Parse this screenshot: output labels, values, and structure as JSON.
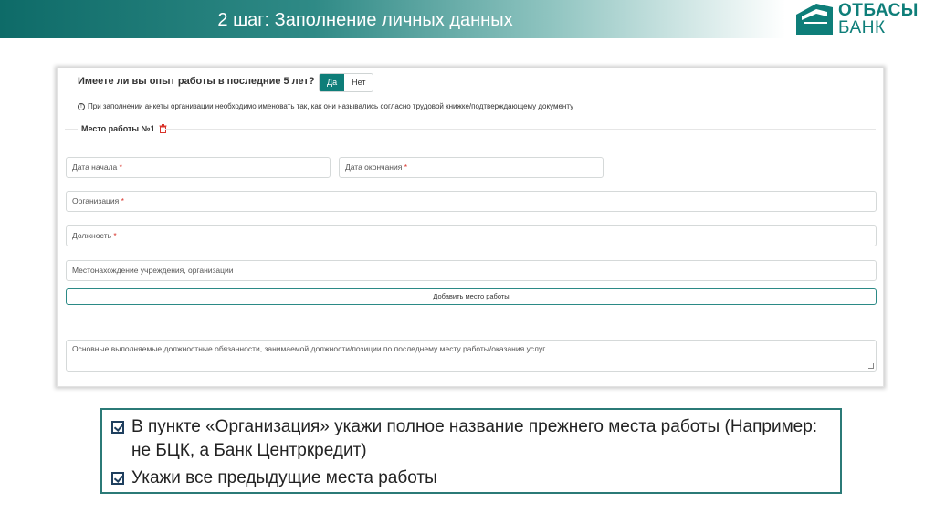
{
  "header": {
    "title": "2 шаг: Заполнение личных данных",
    "logo": {
      "line1": "ОТБАСЫ",
      "line2": "БАНК",
      "color": "#0e7e79"
    }
  },
  "form": {
    "question": "Имеете ли вы опыт работы в последние 5 лет?",
    "options": {
      "yes": "Да",
      "no": "Нет",
      "selected": "Да"
    },
    "info_text": "При заполнении анкеты организации необходимо именовать так, как они назывались согласно трудовой книжке/подтверждающему документу",
    "section_title": "Место работы №1",
    "fields": {
      "start_date": "Дата начала",
      "end_date": "Дата окончания",
      "organization": "Организация",
      "position": "Должность",
      "location": "Местонахождение учреждения, организации"
    },
    "required_mark": "*",
    "add_button": "Добавить место работы",
    "duties_placeholder": "Основные выполняемые должностные обязанности, занимаемой должности/позиции по последнему месту работы/оказания услуг"
  },
  "notes": [
    "В пункте «Организация» укажи полное название прежнего места работы (Например: не БЦК, а Банк Центркредит)",
    "Укажи все предыдущие места работы"
  ],
  "colors": {
    "accent": "#0e7e79",
    "required": "#d9342b",
    "border": "#2b7a77"
  }
}
